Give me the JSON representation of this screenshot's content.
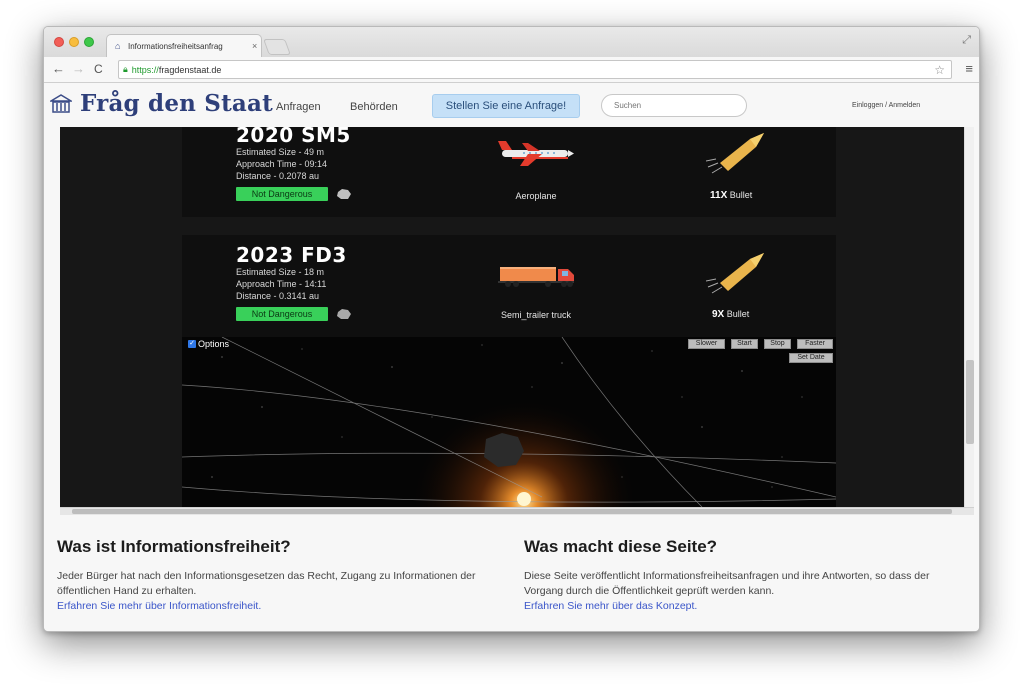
{
  "browser": {
    "tab_title": "Informationsfreiheitsanfrag",
    "tab_close": "×",
    "url_scheme": "https://",
    "url_rest": "fragdenstaat.de",
    "back": "←",
    "forward": "→",
    "reload": "C",
    "star": "☆",
    "menu": "≡",
    "fullscreen": "⤢"
  },
  "site": {
    "logo": "Fråg den Staat",
    "nav": [
      "Anfragen",
      "Behörden"
    ],
    "cta": "Stellen Sie eine Anfrage!",
    "search_placeholder": "Suchen",
    "login": "Einloggen / Anmelden"
  },
  "asteroids": [
    {
      "name": "2020 SM5",
      "size": "Estimated Size - 49 m",
      "approach": "Approach Time - 09:14",
      "distance": "Distance - 0.2078 au",
      "status": "Not Dangerous",
      "comparison": "Aeroplane",
      "bullet_multiplier": "11X",
      "bullet_label": "Bullet",
      "comparison_icon": "airplane-icon"
    },
    {
      "name": "2023 FD3",
      "size": "Estimated Size - 18 m",
      "approach": "Approach Time - 14:11",
      "distance": "Distance - 0.3141 au",
      "status": "Not Dangerous",
      "comparison": "Semi_trailer truck",
      "bullet_multiplier": "9X",
      "bullet_label": "Bullet",
      "comparison_icon": "truck-icon"
    }
  ],
  "scene": {
    "options_label": "Options",
    "controls": [
      "Slower",
      "Start",
      "Stop",
      "Faster"
    ],
    "set_date": "Set Date"
  },
  "info": [
    {
      "title": "Was ist Informationsfreiheit?",
      "text": "Jeder Bürger hat nach den Informationsgesetzen das Recht, Zugang zu Informationen der öffentlichen Hand zu erhalten.",
      "link": "Erfahren Sie mehr über Informationsfreiheit."
    },
    {
      "title": "Was macht diese Seite?",
      "text": "Diese Seite veröffentlicht Informationsfreiheitsanfragen und ihre Antworten, so dass der Vorgang durch die Öffentlichkeit geprüft werden kann.",
      "link": "Erfahren Sie mehr über das Konzept."
    }
  ],
  "colors": {
    "brand": "#2e3f7a",
    "badge": "#39d05a",
    "link": "#3a55c9",
    "cta_bg": "#c5e0f7"
  }
}
